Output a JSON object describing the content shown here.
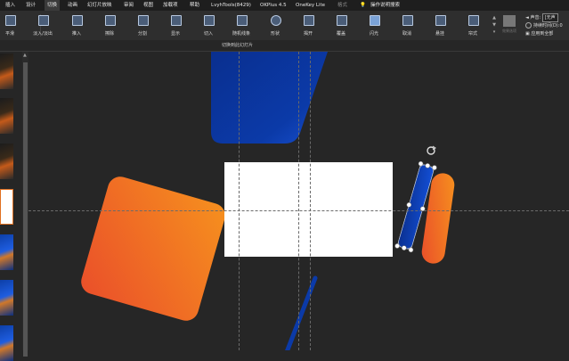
{
  "menubar": {
    "items": [
      "插入",
      "设计",
      "切换",
      "动画",
      "幻灯片放映",
      "审阅",
      "视图",
      "加载项",
      "帮助",
      "LvyhTools(8429)",
      "OKPlus 4.5",
      "OneKey Lite",
      "格式",
      "操作说明搜索"
    ]
  },
  "ribbon": {
    "buttons": [
      "平滑",
      "淡入/淡出",
      "推入",
      "擦除",
      "分割",
      "显示",
      "切入",
      "随机线条",
      "形状",
      "揭开",
      "覆盖",
      "闪光",
      "取消",
      "悬挂",
      "帘式"
    ],
    "preview_label": "效果选项",
    "sound_label": "声音:",
    "sound_value": "[无声",
    "duration_label": "持续时间(D):",
    "duration_value": "0",
    "apply_all_label": "应用到全部"
  },
  "group_label": "切换到此幻灯片",
  "colors": {
    "accent_orange": "#f07a28",
    "accent_blue": "#0b3aa8"
  }
}
